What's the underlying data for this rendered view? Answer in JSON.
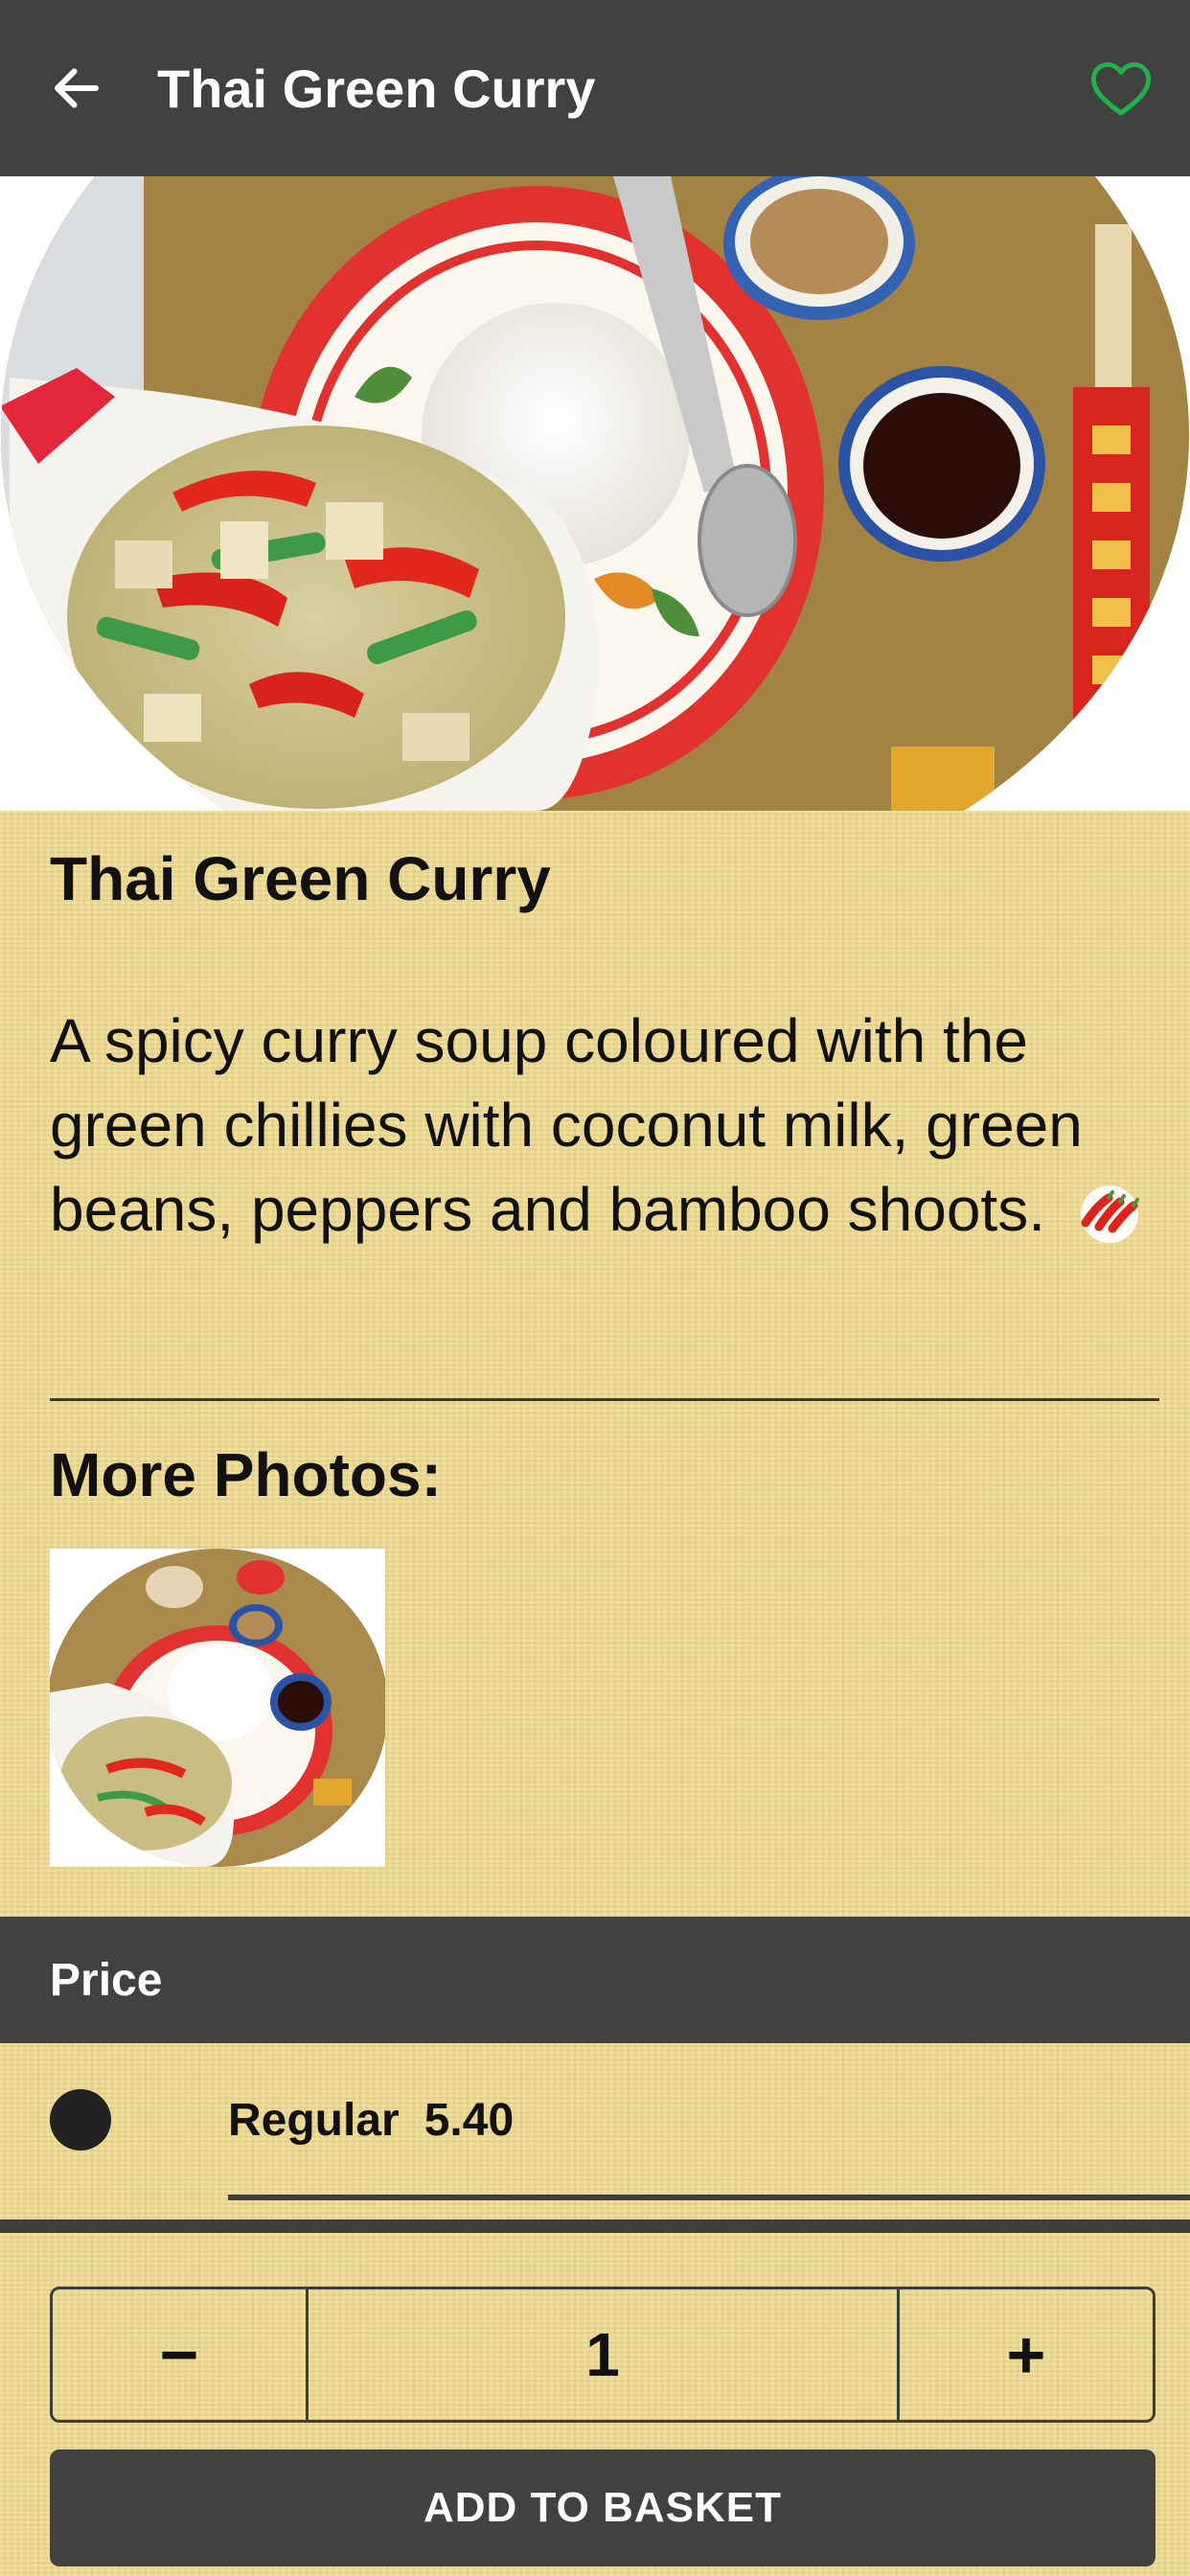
{
  "header": {
    "title": "Thai Green Curry",
    "back_icon": "back-arrow-icon",
    "favorite_icon": "heart-outline-icon",
    "favorite_color": "#22b24c",
    "bar_color": "#414141"
  },
  "dish": {
    "name": "Thai Green Curry",
    "description": "A spicy curry soup coloured with the green chillies with coconut milk, green beans, peppers and bamboo shoots.",
    "spice_icon": "chilli-icon"
  },
  "more_photos": {
    "label": "More Photos:"
  },
  "price_section": {
    "label": "Price",
    "options": [
      {
        "name": "Regular",
        "price": "5.40",
        "selected": true
      }
    ]
  },
  "quantity": {
    "minus": "−",
    "value": "1",
    "plus": "+"
  },
  "add_to_basket": "ADD TO BASKET"
}
